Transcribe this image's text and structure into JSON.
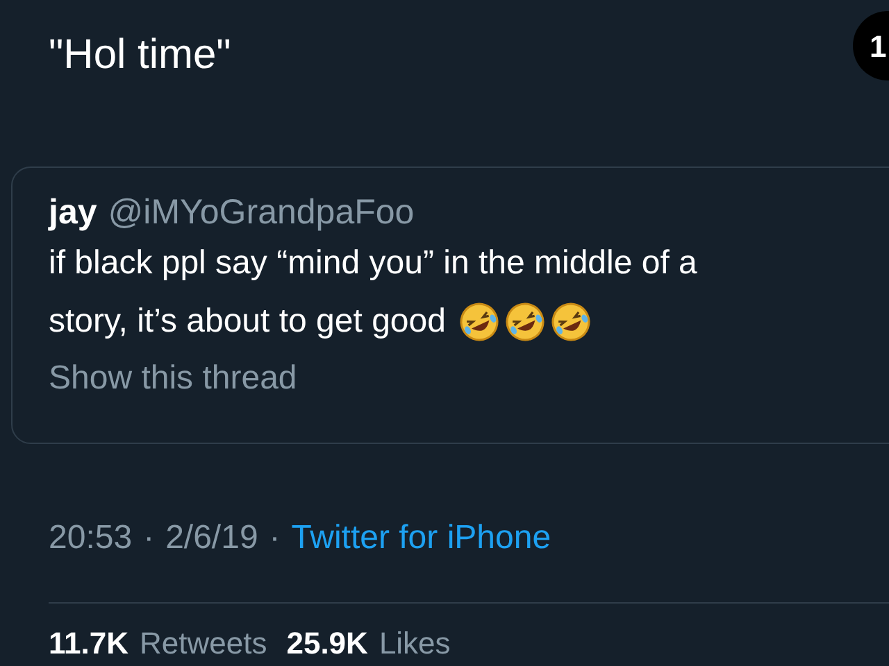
{
  "tweet": {
    "text": "\"Hol time\"",
    "badge": "1"
  },
  "quoted_tweet": {
    "name": "jay",
    "handle": "@iMYoGrandpaFoo",
    "lines": [
      "if black ppl say “mind you” in the middle of a",
      "story, it’s about to get good"
    ],
    "show_thread": "Show this thread"
  },
  "meta": {
    "time": "20:53",
    "separator_1": "·",
    "date": "2/6/19",
    "separator_2": "·",
    "source": "Twitter for iPhone"
  },
  "stats": [
    {
      "count": "11.7K",
      "label": "Retweets"
    },
    {
      "count": "25.9K",
      "label": "Likes"
    }
  ]
}
